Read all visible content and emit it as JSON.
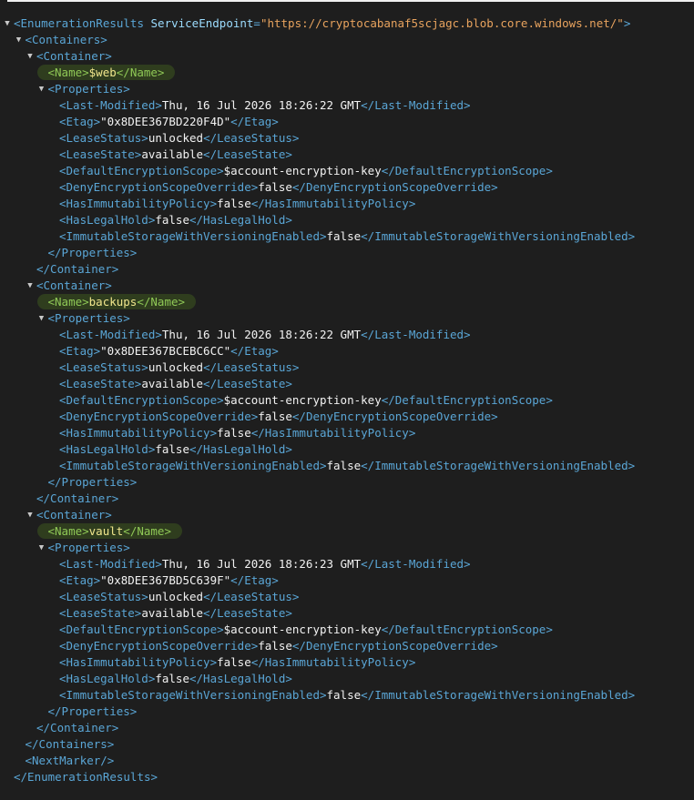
{
  "root": {
    "open_tag": "<EnumerationResults",
    "attr_name": "ServiceEndpoint",
    "attr_eq": "=",
    "attr_value": "\"https://cryptocabanaf5scjagc.blob.core.windows.net/\"",
    "attr_close": ">",
    "close_tag": "</EnumerationResults>"
  },
  "containers_tag": {
    "open": "<Containers>",
    "close": "</Containers>"
  },
  "container_tag": {
    "open": "<Container>",
    "close": "</Container>"
  },
  "properties_tag": {
    "open": "<Properties>",
    "close": "</Properties>"
  },
  "name_tag": {
    "open": "<Name>",
    "close": "</Name>"
  },
  "next_marker": "<NextMarker/>",
  "property_tags": [
    {
      "open": "<Last-Modified>",
      "close": "</Last-Modified>"
    },
    {
      "open": "<Etag>",
      "close": "</Etag>"
    },
    {
      "open": "<LeaseStatus>",
      "close": "</LeaseStatus>"
    },
    {
      "open": "<LeaseState>",
      "close": "</LeaseState>"
    },
    {
      "open": "<DefaultEncryptionScope>",
      "close": "</DefaultEncryptionScope>"
    },
    {
      "open": "<DenyEncryptionScopeOverride>",
      "close": "</DenyEncryptionScopeOverride>"
    },
    {
      "open": "<HasImmutabilityPolicy>",
      "close": "</HasImmutabilityPolicy>"
    },
    {
      "open": "<HasLegalHold>",
      "close": "</HasLegalHold>"
    },
    {
      "open": "<ImmutableStorageWithVersioningEnabled>",
      "close": "</ImmutableStorageWithVersioningEnabled>"
    }
  ],
  "containers": [
    {
      "name": "$web",
      "properties": [
        "Thu, 16 Jul 2026 18:26:22 GMT",
        "\"0x8DEE367BD220F4D\"",
        "unlocked",
        "available",
        "$account-encryption-key",
        "false",
        "false",
        "false",
        "false"
      ]
    },
    {
      "name": "backups",
      "properties": [
        "Thu, 16 Jul 2026 18:26:22 GMT",
        "\"0x8DEE367BCEBC6CC\"",
        "unlocked",
        "available",
        "$account-encryption-key",
        "false",
        "false",
        "false",
        "false"
      ]
    },
    {
      "name": "vault",
      "properties": [
        "Thu, 16 Jul 2026 18:26:23 GMT",
        "\"0x8DEE367BD5C639F\"",
        "unlocked",
        "available",
        "$account-encryption-key",
        "false",
        "false",
        "false",
        "false"
      ]
    }
  ],
  "colors": {
    "background": "#1e1e1e",
    "tag": "#5aa6d6",
    "attribute_value": "#e8a35e",
    "text": "#f2f2f2",
    "name_highlight_bg": "#2f3d1e",
    "name_highlight_tag": "#8fc856",
    "name_highlight_text": "#f0e68c"
  },
  "icons": {
    "expanded_toggle": "triangle-down-icon"
  }
}
